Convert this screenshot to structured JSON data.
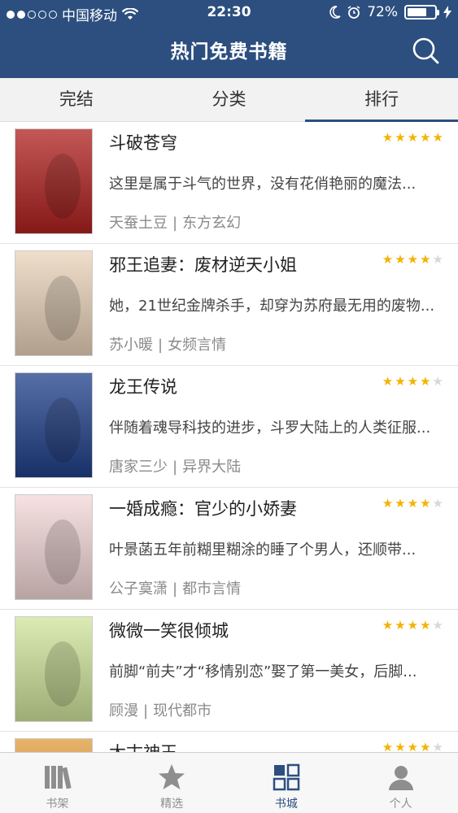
{
  "status": {
    "carrier": "中国移动",
    "time": "22:30",
    "battery": "72%",
    "battery_level": 0.72
  },
  "header": {
    "title": "热门免费书籍",
    "search_icon": "search-icon"
  },
  "tabs": [
    {
      "label": "完结"
    },
    {
      "label": "分类"
    },
    {
      "label": "排行",
      "active": true
    }
  ],
  "books": [
    {
      "title": "斗破苍穹",
      "rating": 5,
      "desc": "这里是属于斗气的世界，没有花俏艳丽的魔法...",
      "author": "天蚕土豆",
      "category": "东方玄幻",
      "cover_color": "#b0201e"
    },
    {
      "title": "邪王追妻：废材逆天小姐",
      "rating": 3.5,
      "desc": "她，21世纪金牌杀手，却穿为苏府最无用的废物...",
      "author": "苏小暖",
      "category": "女频言情",
      "cover_color": "#e9d3b9"
    },
    {
      "title": "龙王传说",
      "rating": 3.5,
      "desc": "伴随着魂导科技的进步，斗罗大陆上的人类征服...",
      "author": "唐家三少",
      "category": "异界大陆",
      "cover_color": "#1f3f8a"
    },
    {
      "title": "一婚成瘾：官少的小娇妻",
      "rating": 4,
      "desc": "叶景菡五年前糊里糊涂的睡了个男人，还顺带...",
      "author": "公子寞潇",
      "category": "都市言情",
      "cover_color": "#f4d8d8"
    },
    {
      "title": "微微一笑很倾城",
      "rating": 4,
      "desc": "前脚“前夫”才“移情别恋”娶了第一美女，后脚...",
      "author": "顾漫",
      "category": "现代都市",
      "cover_color": "#cfe59a"
    },
    {
      "title": "太古神王",
      "rating": 3.5,
      "desc": "",
      "author": "",
      "category": "",
      "cover_color": "#e09a3a"
    }
  ],
  "tabbar": [
    {
      "label": "书架",
      "icon": "bookshelf-icon"
    },
    {
      "label": "精选",
      "icon": "star-icon"
    },
    {
      "label": "书城",
      "icon": "grid-icon",
      "active": true
    },
    {
      "label": "个人",
      "icon": "person-icon"
    }
  ],
  "colors": {
    "brand": "#2c4f7f",
    "star": "#f3b300"
  }
}
